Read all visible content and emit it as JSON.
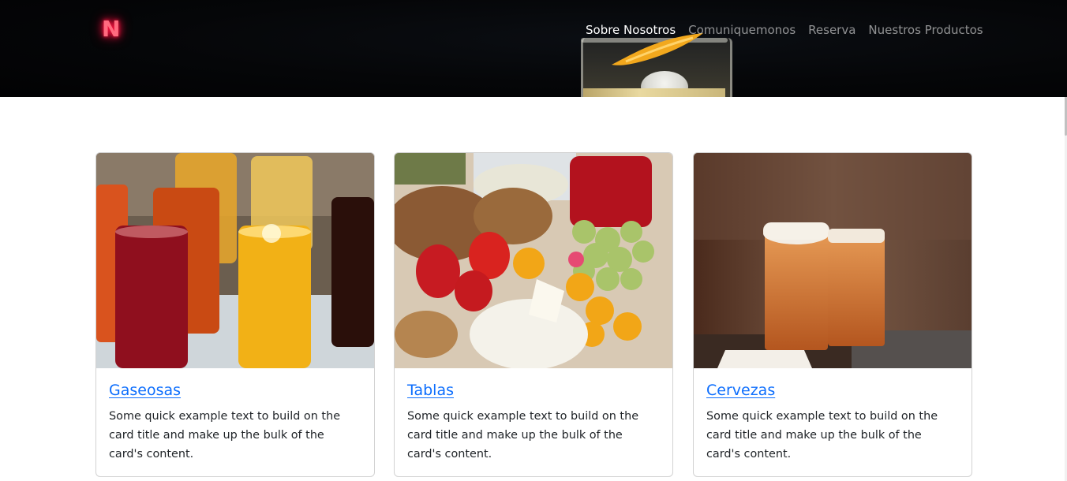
{
  "brand": {
    "logo_letter": "N",
    "logo_color": "#ff1744"
  },
  "nav": {
    "items": [
      {
        "label": "Sobre Nosotros",
        "active": true
      },
      {
        "label": "Comuniquemonos",
        "active": false
      },
      {
        "label": "Reserva",
        "active": false
      },
      {
        "label": "Nuestros Productos",
        "active": false
      }
    ]
  },
  "cards": [
    {
      "title": "Gaseosas",
      "text": "Some quick example text to build on the card title and make up the bulk of the card's content.",
      "image": "soft-drinks-photo"
    },
    {
      "title": "Tablas",
      "text": "Some quick example text to build on the card title and make up the bulk of the card's content.",
      "image": "cheese-board-photo"
    },
    {
      "title": "Cervezas",
      "text": "Some quick example text to build on the card title and make up the bulk of the card's content.",
      "image": "beer-glasses-photo"
    }
  ],
  "colors": {
    "link": "#0d6efd",
    "header_bg": "#050608",
    "text": "#212529"
  }
}
